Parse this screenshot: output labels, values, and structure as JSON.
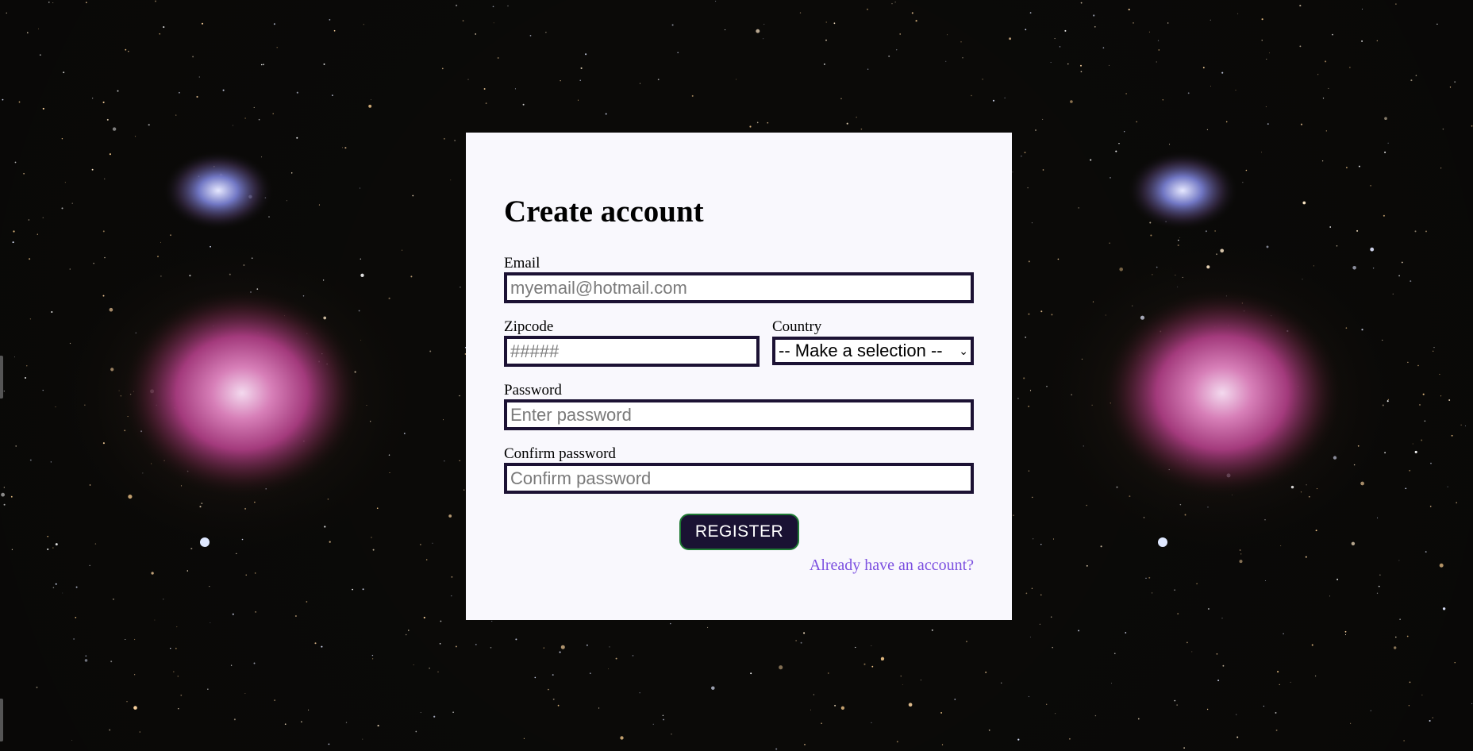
{
  "form": {
    "title": "Create account",
    "email": {
      "label": "Email",
      "placeholder": "myemail@hotmail.com"
    },
    "zipcode": {
      "label": "Zipcode",
      "placeholder": "#####"
    },
    "country": {
      "label": "Country",
      "selected": "-- Make a selection --"
    },
    "password": {
      "label": "Password",
      "placeholder": "Enter password"
    },
    "confirm_password": {
      "label": "Confirm password",
      "placeholder": "Confirm password"
    },
    "register_label": "REGISTER",
    "signin_link": "Already have an account?"
  },
  "colors": {
    "card_background": "#f9f8fd",
    "field_border": "#1c1234",
    "button_background": "#1a1233",
    "button_border": "#1f7a33",
    "link": "#7b4fe0"
  }
}
